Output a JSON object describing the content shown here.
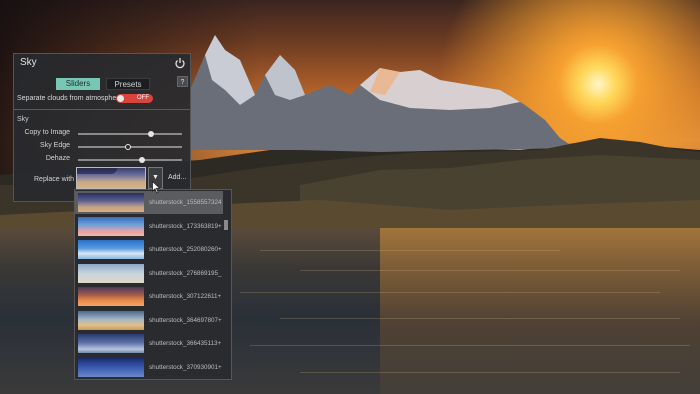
{
  "panel": {
    "title": "Sky",
    "icons": {
      "power": "power-icon",
      "help": "?"
    },
    "tabs": [
      {
        "label": "Sliders",
        "active": true
      },
      {
        "label": "Presets",
        "active": false
      }
    ],
    "separate_clouds": {
      "label": "Separate clouds from atmosphere",
      "state": "OFF",
      "value": false
    },
    "section": "Sky",
    "sliders": [
      {
        "label": "Copy to Image",
        "value": 0.7
      },
      {
        "label": "Sky Edge",
        "value": 0.48
      },
      {
        "label": "Dehaze",
        "value": 0.62
      }
    ],
    "replace_with": {
      "label": "Replace with",
      "dropdown_icon": "▼",
      "add_label": "Add..."
    }
  },
  "sky_list": {
    "items": [
      {
        "label": "shutterstock_1558557324",
        "selected": true,
        "thumb": "sunset-purple"
      },
      {
        "label": "shutterstock_173363819+",
        "selected": false,
        "thumb": "pink-blue-clouds"
      },
      {
        "label": "shutterstock_252080260+",
        "selected": false,
        "thumb": "blue-clouds"
      },
      {
        "label": "shutterstock_276869195_",
        "selected": false,
        "thumb": "pale-clouds"
      },
      {
        "label": "shutterstock_307122611+",
        "selected": false,
        "thumb": "orange-sunset"
      },
      {
        "label": "shutterstock_364697807+",
        "selected": false,
        "thumb": "golden-clouds"
      },
      {
        "label": "shutterstock_366435113+",
        "selected": false,
        "thumb": "blue-dusk"
      },
      {
        "label": "shutterstock_370930901+",
        "selected": false,
        "thumb": "deep-blue"
      }
    ]
  },
  "colors": {
    "accent": "#78c6b4",
    "toggle_off": "#d9443d",
    "panel_bg": "#28292e"
  }
}
